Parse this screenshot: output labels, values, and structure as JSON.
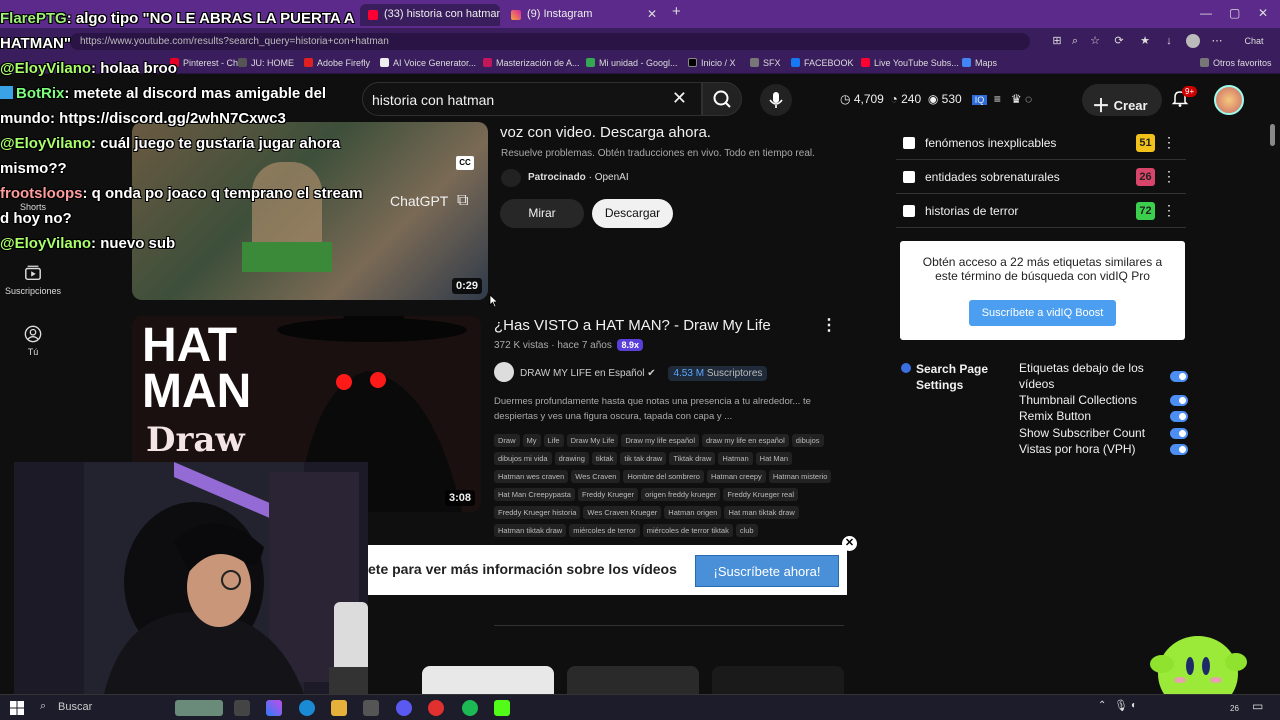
{
  "browser": {
    "tabs": [
      {
        "label": "(33) historia con hatman - YouTub",
        "active": true
      },
      {
        "label": "(9) Instagram",
        "active": false
      }
    ],
    "url": "https://www.youtube.com/results?search_query=historia+con+hatman",
    "chat_button": "Chat",
    "bookmarks": [
      "Pinterest - Chile",
      "JU: HOME",
      "Adobe Firefly",
      "AI Voice Generator...",
      "Masterización de A...",
      "Mi unidad - Googl...",
      "Inicio / X",
      "SFX",
      "FACEBOOK",
      "Live YouTube Subs...",
      "Maps"
    ],
    "other_bookmarks": "Otros favoritos"
  },
  "youtube": {
    "search_value": "historia con hatman",
    "header_stats": {
      "views": "4,709",
      "likes": "240",
      "watching": "530"
    },
    "create_label": "Crear",
    "notif_count": "9+",
    "left_nav": [
      {
        "label": "Shorts"
      },
      {
        "label": "Suscripciones"
      },
      {
        "label": "Tú"
      }
    ],
    "ad": {
      "title": "voz con video. Descarga ahora.",
      "description": "Resuelve problemas. Obtén traducciones en vivo. Todo en tiempo real.",
      "sponsor_label": "Patrocinado",
      "advertiser": "OpenAI",
      "thumb_label": "ChatGPT",
      "thumb_cc": "CC",
      "duration": "0:29",
      "watch_label": "Mirar",
      "download_label": "Descargar"
    },
    "video": {
      "title": "¿Has VISTO a HAT MAN? - Draw My Life",
      "views": "372 K vistas",
      "age": "hace 7 años",
      "vph_badge": "8.9x",
      "channel": "DRAW MY LIFE en Español",
      "subscribers": "4.53 M",
      "subscribers_label": "Suscriptores",
      "description": "Duermes profundamente hasta que notas una presencia a tu alrededor... te despiertas y ves una figura oscura, tapada con capa y ...",
      "duration": "3:08",
      "thumb_text_1": "HAT",
      "thumb_text_2": "MAN",
      "thumb_text_3": "Draw",
      "tags": [
        "Draw",
        "My",
        "Life",
        "Draw My Life",
        "Draw my life español",
        "draw my life en español",
        "dibujos",
        "dibujos mi vida",
        "drawing",
        "tiktak",
        "tik tak draw",
        "Tiktak draw",
        "Hatman",
        "Hat Man",
        "Hatman wes craven",
        "Wes Craven",
        "Hombre del sombrero",
        "Hatman creepy",
        "Hatman misterio",
        "Hat Man Creepypasta",
        "Freddy Krueger",
        "origen freddy krueger",
        "Freddy Krueger real",
        "Freddy Krueger historia",
        "Wes Craven Krueger",
        "Hatman origen",
        "Hat man tiktak draw",
        "Hatman tiktak draw",
        "miércoles de terror",
        "miércoles de terror tiktak",
        "club"
      ]
    },
    "upsell": {
      "text": "ete para ver más información sobre los vídeos",
      "button": "¡Suscríbete ahora!",
      "close": "✕"
    }
  },
  "vidiq": {
    "tags": [
      {
        "label": "fenómenos inexplicables",
        "score": "51",
        "color": "#f2c21b"
      },
      {
        "label": "entidades sobrenaturales",
        "score": "26",
        "color": "#d9456a"
      },
      {
        "label": "historias de terror",
        "score": "72",
        "color": "#3ccf4e"
      }
    ],
    "promo_text": "Obtén acceso a 22 más etiquetas similares a este término de búsqueda con vidIQ Pro",
    "promo_button": "Suscríbete a vidIQ Boost",
    "settings_title": "Search Page Settings",
    "settings": [
      {
        "label": "Etiquetas debajo de los vídeos",
        "on": true
      },
      {
        "label": "Thumbnail Collections",
        "on": true
      },
      {
        "label": "Remix Button",
        "on": true
      },
      {
        "label": "Show Subscriber Count",
        "on": true
      },
      {
        "label": "Vistas por hora (VPH)",
        "on": true
      }
    ]
  },
  "chat": [
    {
      "user": "FlarePTG",
      "text": ": algo tipo \"NO LE ABRAS LA PUERTA A HATMAN\""
    },
    {
      "user": "@EloyVilano",
      "text": ": holaa broo"
    },
    {
      "user": "BotRix",
      "text": ": metete al discord mas amigable del mundo: https://discord.gg/2whN7Cxwc3"
    },
    {
      "user": "@EloyVilano",
      "text": ": cuál juego te gustaría jugar ahora mismo??"
    },
    {
      "user": "frootsloops",
      "text": ": q onda po joaco q temprano el stream d hoy no?"
    },
    {
      "user": "@EloyVilano",
      "text": ": nuevo sub"
    }
  ],
  "taskbar": {
    "search_placeholder": "Buscar",
    "date_fragment": "26"
  }
}
